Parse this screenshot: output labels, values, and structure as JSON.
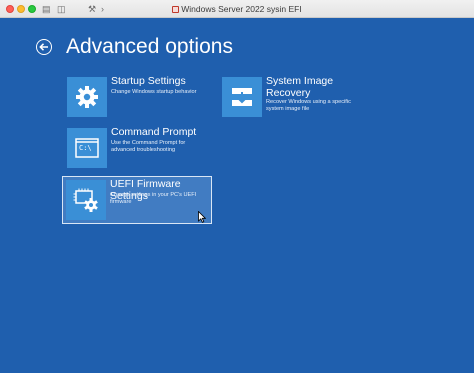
{
  "window": {
    "title": "Windows Server 2022 sysin EFI"
  },
  "page": {
    "title": "Advanced options",
    "back_icon": "back-arrow-icon"
  },
  "options": [
    {
      "label": "Startup Settings",
      "description": "Change Windows startup behavior",
      "icon": "gear-icon"
    },
    {
      "label_line1": "System Image",
      "label_line2": "Recovery",
      "description_line1": "Recover Windows using a specific",
      "description_line2": "system image file",
      "icon": "system-image-icon"
    },
    {
      "label": "Command Prompt",
      "description_line1": "Use the Command Prompt for",
      "description_line2": "advanced troubleshooting",
      "icon": "command-prompt-icon",
      "icon_text": "C:\\"
    },
    {
      "label": "UEFI Firmware Settings",
      "description_line1": "Change settings in your PC's UEFI",
      "description_line2": "firmware",
      "icon": "firmware-chip-gear-icon",
      "selected": true
    }
  ],
  "colors": {
    "background": "#1f5fae",
    "tile": "#3a8fd6",
    "text": "#ffffff"
  }
}
